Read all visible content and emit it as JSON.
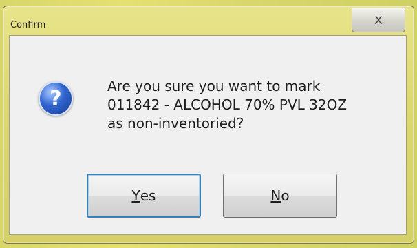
{
  "window": {
    "title": "Confirm",
    "close_glyph": "X"
  },
  "icon": {
    "name": "question-icon",
    "glyph": "?"
  },
  "message": {
    "lines": [
      "Are you sure you want to mark",
      "011842 - ALCOHOL 70% PVL 32OZ",
      "as non-inventoried?"
    ]
  },
  "buttons": {
    "yes": {
      "mnemonic": "Y",
      "rest": "es"
    },
    "no": {
      "mnemonic": "N",
      "rest": "o"
    }
  }
}
